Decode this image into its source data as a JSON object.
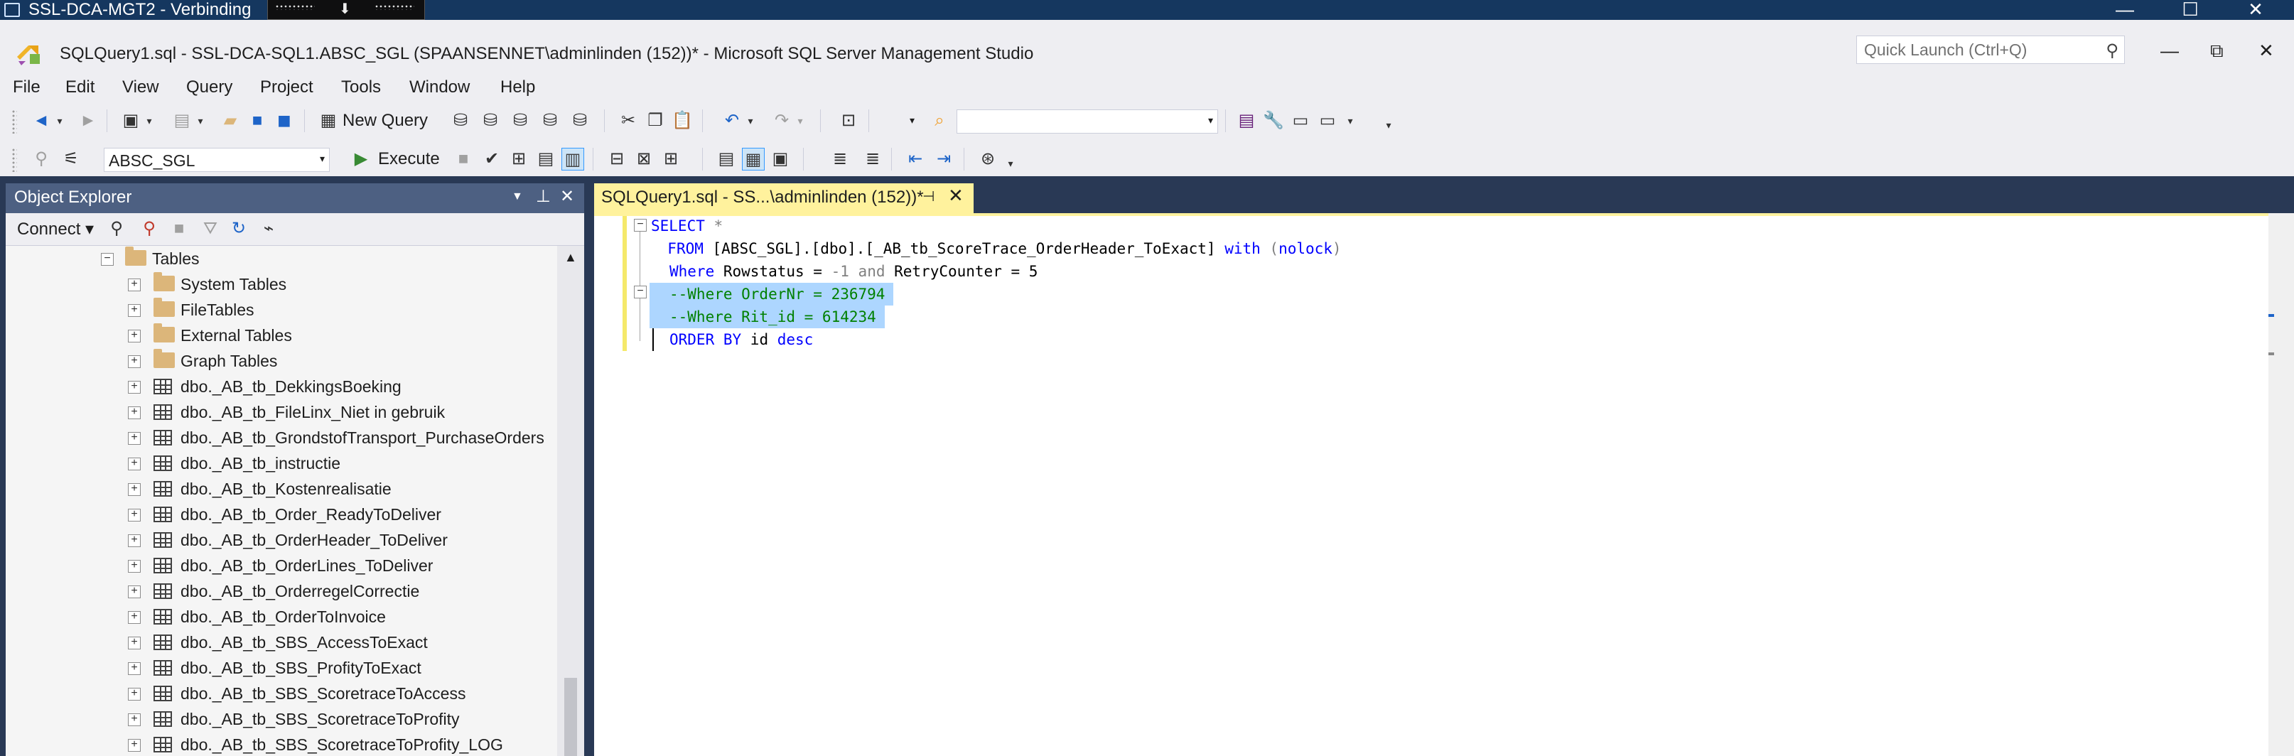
{
  "remote": {
    "title": "SSL-DCA-MGT2 - Verbinding",
    "controls": {
      "minimize": "—",
      "maximize": "☐",
      "close": "✕"
    }
  },
  "window": {
    "title": "SQLQuery1.sql - SSL-DCA-SQL1.ABSC_SGL (SPAANSENNET\\adminlinden (152))* - Microsoft SQL Server Management Studio",
    "quick_launch_placeholder": "Quick Launch (Ctrl+Q)",
    "controls": {
      "minimize": "—",
      "restore": "⧉",
      "close": "✕"
    }
  },
  "menu": [
    "File",
    "Edit",
    "View",
    "Query",
    "Project",
    "Tools",
    "Window",
    "Help"
  ],
  "toolbar": {
    "new_query": "New Query",
    "database": "ABSC_SGL",
    "execute": "Execute",
    "solution_config": ""
  },
  "object_explorer": {
    "title": "Object Explorer",
    "connect_label": "Connect",
    "tree": [
      {
        "label": "Tables",
        "kind": "folder",
        "level": 0,
        "expander": "−"
      },
      {
        "label": "System Tables",
        "kind": "folder",
        "level": 1,
        "expander": "+"
      },
      {
        "label": "FileTables",
        "kind": "folder",
        "level": 1,
        "expander": "+"
      },
      {
        "label": "External Tables",
        "kind": "folder",
        "level": 1,
        "expander": "+"
      },
      {
        "label": "Graph Tables",
        "kind": "folder",
        "level": 1,
        "expander": "+"
      },
      {
        "label": "dbo._AB_tb_DekkingsBoeking",
        "kind": "table",
        "level": 1,
        "expander": "+"
      },
      {
        "label": "dbo._AB_tb_FileLinx_Niet in gebruik",
        "kind": "table",
        "level": 1,
        "expander": "+"
      },
      {
        "label": "dbo._AB_tb_GrondstofTransport_PurchaseOrders",
        "kind": "table",
        "level": 1,
        "expander": "+"
      },
      {
        "label": "dbo._AB_tb_instructie",
        "kind": "table",
        "level": 1,
        "expander": "+"
      },
      {
        "label": "dbo._AB_tb_Kostenrealisatie",
        "kind": "table",
        "level": 1,
        "expander": "+"
      },
      {
        "label": "dbo._AB_tb_Order_ReadyToDeliver",
        "kind": "table",
        "level": 1,
        "expander": "+"
      },
      {
        "label": "dbo._AB_tb_OrderHeader_ToDeliver",
        "kind": "table",
        "level": 1,
        "expander": "+"
      },
      {
        "label": "dbo._AB_tb_OrderLines_ToDeliver",
        "kind": "table",
        "level": 1,
        "expander": "+"
      },
      {
        "label": "dbo._AB_tb_OrderregelCorrectie",
        "kind": "table",
        "level": 1,
        "expander": "+"
      },
      {
        "label": "dbo._AB_tb_OrderToInvoice",
        "kind": "table",
        "level": 1,
        "expander": "+"
      },
      {
        "label": "dbo._AB_tb_SBS_AccessToExact",
        "kind": "table",
        "level": 1,
        "expander": "+"
      },
      {
        "label": "dbo._AB_tb_SBS_ProfityToExact",
        "kind": "table",
        "level": 1,
        "expander": "+"
      },
      {
        "label": "dbo._AB_tb_SBS_ScoretraceToAccess",
        "kind": "table",
        "level": 1,
        "expander": "+"
      },
      {
        "label": "dbo._AB_tb_SBS_ScoretraceToProfity",
        "kind": "table",
        "level": 1,
        "expander": "+"
      },
      {
        "label": "dbo._AB_tb_SBS_ScoretraceToProfity_LOG",
        "kind": "table",
        "level": 1,
        "expander": "+"
      }
    ]
  },
  "editor": {
    "tab_label": "SQLQuery1.sql - SS...\\adminlinden (152))*",
    "code": {
      "l1_kw": "SELECT",
      "l1_rest": " *",
      "l2_indent": "  ",
      "l2_kw": "FROM",
      "l2_obj": " [ABSC_SGL].[dbo].[_AB_tb_ScoreTrace_OrderHeader_ToExact] ",
      "l2_with": "with",
      "l2_open": " (",
      "l2_nolock": "nolock",
      "l2_close": ")",
      "l3_kw": "Where",
      "l3_a": " Rowstatus = ",
      "l3_b": "-1",
      "l3_c": " ",
      "l3_and": "and",
      "l3_d": " RetryCounter = 5",
      "l4": "--Where OrderNr = 236794",
      "l5": "--Where Rit_id = 614234",
      "l6_kw": "ORDER BY",
      "l6_a": " id ",
      "l6_desc": "desc"
    }
  }
}
